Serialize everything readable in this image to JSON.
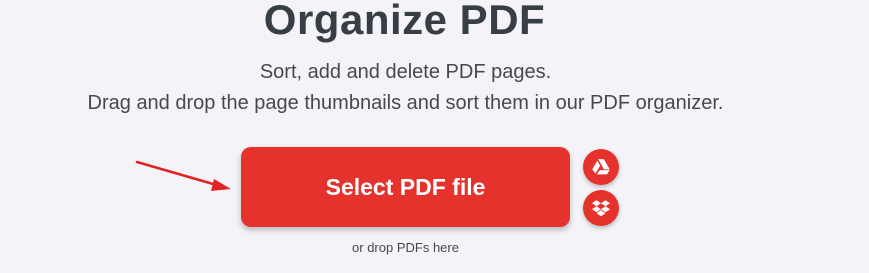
{
  "header": {
    "title": "Organize PDF",
    "subtitle_line1": "Sort, add and delete PDF pages.",
    "subtitle_line2": "Drag and drop the page thumbnails and sort them in our PDF organizer."
  },
  "upload": {
    "select_label": "Select PDF file",
    "drop_hint": "or drop PDFs here",
    "sources": [
      {
        "name": "google-drive",
        "icon": "google-drive-icon"
      },
      {
        "name": "dropbox",
        "icon": "dropbox-icon"
      }
    ]
  },
  "colors": {
    "accent": "#e5322d",
    "background": "#f4f4f8",
    "title": "#383e45",
    "annotation_arrow": "#e02424"
  }
}
